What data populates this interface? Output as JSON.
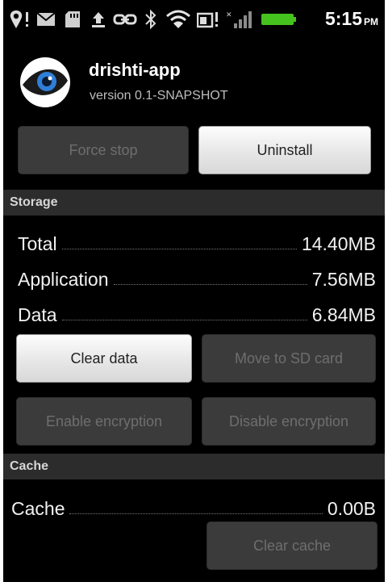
{
  "app": {
    "name": "drishti-app",
    "version": "version 0.1-SNAPSHOT"
  },
  "status_bar": {
    "time": "5:15",
    "ampm": "PM",
    "icons": [
      "location-alert-icon",
      "email-icon",
      "sd-card-icon",
      "upload-icon",
      "link-icon",
      "bluetooth-icon",
      "wifi-icon",
      "battery-alert-icon",
      "signal-icon",
      "battery-icon"
    ]
  },
  "buttons": {
    "force_stop": "Force stop",
    "uninstall": "Uninstall",
    "clear_data": "Clear data",
    "move_to_sd": "Move to SD card",
    "enable_encryption": "Enable encryption",
    "disable_encryption": "Disable encryption",
    "clear_cache": "Clear cache"
  },
  "storage": {
    "header": "Storage",
    "rows": [
      {
        "label": "Total",
        "value": "14.40MB"
      },
      {
        "label": "Application",
        "value": "7.56MB"
      },
      {
        "label": "Data",
        "value": "6.84MB"
      }
    ]
  },
  "cache": {
    "header": "Cache",
    "rows": [
      {
        "label": "Cache",
        "value": "0.00B"
      }
    ]
  },
  "colors": {
    "background": "#000000",
    "section_header": "#2c2c2c",
    "battery": "#46c21f"
  }
}
